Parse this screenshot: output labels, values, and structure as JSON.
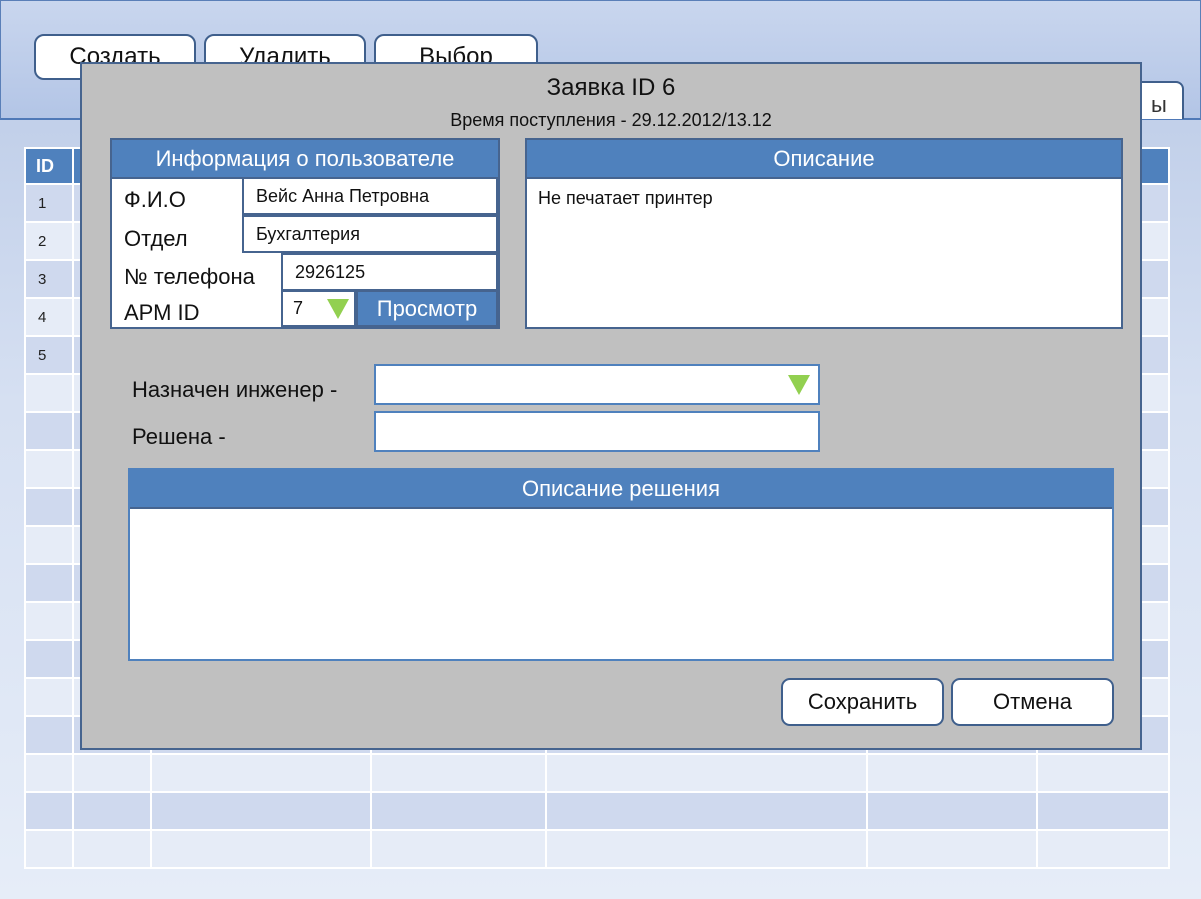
{
  "toolbar": {
    "create_label": "Создать",
    "delete_label": "Удалить",
    "select_label": "Выбор",
    "tab_label": "ы"
  },
  "table": {
    "id_header": "ID",
    "row_ids": [
      "1",
      "2",
      "3",
      "4",
      "5"
    ]
  },
  "dialog": {
    "title": "Заявка ID 6",
    "received": "Время поступления  - 29.12.2012/13.12",
    "user_info": {
      "header": "Информация о пользователе",
      "fio_label": "Ф.И.О",
      "fio_value": "Вейс Анна Петровна",
      "dept_label": "Отдел",
      "dept_value": "Бухгалтерия",
      "phone_label": "№ телефона",
      "phone_value": "2926125",
      "arm_label": "АРМ ID",
      "arm_value": "7",
      "view_button": "Просмотр"
    },
    "description": {
      "header": "Описание",
      "text": "Не печатает принтер"
    },
    "engineer_label": "Назначен инженер -",
    "engineer_value": "",
    "resolved_label": "Решена -",
    "resolved_value": "",
    "solution": {
      "header": "Описание решения",
      "text": ""
    },
    "save_label": "Сохранить",
    "cancel_label": "Отмена"
  },
  "colors": {
    "accent": "#4f81bd",
    "border": "#46648f",
    "dialog_bg": "#c0c0c0",
    "dropdown_arrow": "#92d050"
  },
  "icons": {
    "dropdown": "triangle-down-icon"
  }
}
